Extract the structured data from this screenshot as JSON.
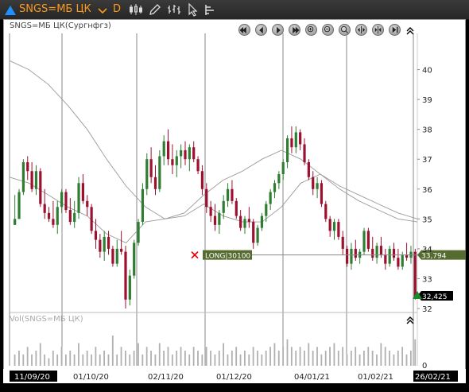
{
  "toolbar": {
    "symbol": "SNGS=МБ ЦК",
    "interval": "D",
    "accent_color": "#ff9a1a",
    "icons": [
      "triangle-up-icon",
      "chevron-down-icon",
      "candlestick-icon",
      "pencil-icon",
      "bar-style-icon",
      "cursor-icon",
      "indicators-icon"
    ]
  },
  "main_panel": {
    "title": "SNGS=МБ ЦК(Сургнфгз)",
    "nav_buttons": [
      "first-icon",
      "prev-icon",
      "play-icon",
      "last-icon",
      "zoom-in-icon",
      "zoom-out-icon",
      "zoom-fit-icon",
      "expand-icon",
      "compress-icon",
      "end-icon",
      "collapse-up-icon"
    ]
  },
  "volume_panel": {
    "title": "Vol(SNGS=МБ ЦК)",
    "zero_label": "0"
  },
  "order_line": {
    "label": "LONG|30100",
    "price": 33.794,
    "price_label": "33,794",
    "color": "#556b2f"
  },
  "last_price": {
    "value": 32.425,
    "label": "32,425"
  },
  "chart_data": {
    "type": "candlestick",
    "ylim": [
      32,
      41
    ],
    "y_ticks": [
      32,
      33,
      34,
      35,
      36,
      37,
      38,
      39,
      40
    ],
    "x_labels": [
      "11/09/20",
      "01/10/20",
      "02/11/20",
      "01/12/20",
      "04/01/21",
      "01/02/21",
      "26/02/21"
    ],
    "up_color": "#2e7d32",
    "down_color": "#9c1030",
    "candles": [
      [
        34.8,
        35.8,
        34.8,
        35.0
      ],
      [
        35.0,
        36.0,
        35.0,
        35.9
      ],
      [
        35.9,
        37.0,
        35.8,
        36.9
      ],
      [
        36.9,
        37.1,
        36.3,
        36.6
      ],
      [
        36.6,
        36.9,
        35.9,
        36.0
      ],
      [
        36.0,
        36.8,
        35.8,
        36.6
      ],
      [
        36.6,
        36.7,
        35.4,
        35.5
      ],
      [
        35.5,
        36.0,
        35.0,
        35.2
      ],
      [
        35.2,
        35.4,
        34.9,
        35.0
      ],
      [
        35.0,
        35.6,
        34.7,
        34.8
      ],
      [
        34.8,
        35.6,
        34.5,
        35.4
      ],
      [
        35.4,
        36.0,
        35.2,
        35.9
      ],
      [
        35.9,
        36.0,
        35.2,
        35.3
      ],
      [
        35.3,
        35.7,
        34.8,
        34.9
      ],
      [
        34.9,
        35.6,
        34.7,
        35.2
      ],
      [
        35.2,
        36.4,
        35.0,
        36.2
      ],
      [
        36.2,
        36.5,
        35.5,
        35.6
      ],
      [
        35.6,
        35.8,
        35.1,
        35.4
      ],
      [
        35.4,
        35.5,
        34.5,
        34.6
      ],
      [
        34.6,
        35.0,
        34.0,
        34.3
      ],
      [
        34.3,
        34.5,
        33.7,
        33.9
      ],
      [
        33.9,
        34.6,
        33.6,
        34.4
      ],
      [
        34.4,
        34.6,
        33.8,
        34.0
      ],
      [
        34.0,
        34.1,
        33.4,
        33.5
      ],
      [
        33.5,
        34.3,
        33.4,
        34.0
      ],
      [
        34.0,
        34.6,
        33.8,
        33.9
      ],
      [
        33.9,
        34.1,
        32.0,
        32.3
      ],
      [
        32.3,
        33.3,
        32.1,
        33.1
      ],
      [
        33.1,
        34.3,
        33.0,
        34.2
      ],
      [
        34.2,
        35.0,
        34.1,
        34.9
      ],
      [
        34.9,
        36.2,
        34.8,
        36.0
      ],
      [
        36.0,
        37.2,
        35.8,
        37.0
      ],
      [
        37.0,
        37.4,
        36.2,
        36.4
      ],
      [
        36.4,
        36.8,
        35.8,
        36.0
      ],
      [
        36.0,
        37.3,
        35.9,
        37.1
      ],
      [
        37.1,
        37.8,
        36.8,
        37.6
      ],
      [
        37.6,
        38.0,
        36.8,
        37.0
      ],
      [
        37.0,
        37.5,
        36.5,
        36.8
      ],
      [
        36.8,
        37.3,
        36.4,
        37.1
      ],
      [
        37.1,
        37.5,
        36.7,
        37.3
      ],
      [
        37.3,
        37.6,
        36.8,
        37.0
      ],
      [
        37.0,
        37.5,
        36.6,
        37.4
      ],
      [
        37.4,
        37.6,
        36.9,
        37.0
      ],
      [
        37.0,
        37.1,
        36.5,
        36.6
      ],
      [
        36.6,
        36.8,
        35.8,
        36.0
      ],
      [
        36.0,
        36.2,
        35.2,
        35.4
      ],
      [
        35.4,
        35.6,
        34.9,
        35.1
      ],
      [
        35.1,
        35.5,
        34.6,
        34.8
      ],
      [
        34.8,
        35.3,
        34.5,
        35.2
      ],
      [
        35.2,
        35.8,
        35.0,
        35.6
      ],
      [
        35.6,
        36.2,
        35.4,
        36.0
      ],
      [
        36.0,
        36.3,
        35.5,
        35.6
      ],
      [
        35.6,
        35.7,
        35.0,
        35.1
      ],
      [
        35.1,
        35.3,
        34.6,
        34.7
      ],
      [
        34.7,
        35.1,
        34.5,
        35.0
      ],
      [
        35.0,
        35.4,
        34.7,
        34.9
      ],
      [
        34.9,
        35.0,
        34.0,
        34.2
      ],
      [
        34.2,
        34.8,
        34.1,
        34.7
      ],
      [
        34.7,
        35.2,
        34.6,
        35.1
      ],
      [
        35.1,
        35.6,
        34.9,
        35.5
      ],
      [
        35.5,
        36.0,
        35.3,
        35.9
      ],
      [
        35.9,
        36.3,
        35.7,
        36.2
      ],
      [
        36.2,
        36.6,
        36.0,
        36.5
      ],
      [
        36.5,
        37.0,
        36.3,
        36.9
      ],
      [
        36.9,
        37.8,
        36.7,
        37.7
      ],
      [
        37.7,
        38.1,
        37.2,
        37.4
      ],
      [
        37.4,
        38.1,
        37.2,
        37.9
      ],
      [
        37.9,
        38.0,
        37.3,
        37.5
      ],
      [
        37.5,
        37.7,
        36.8,
        36.9
      ],
      [
        36.9,
        37.0,
        36.3,
        36.4
      ],
      [
        36.4,
        36.6,
        35.8,
        36.0
      ],
      [
        36.0,
        36.4,
        35.7,
        36.2
      ],
      [
        36.2,
        36.3,
        35.4,
        35.5
      ],
      [
        35.5,
        35.6,
        34.9,
        35.0
      ],
      [
        35.0,
        35.1,
        34.4,
        34.6
      ],
      [
        34.6,
        35.0,
        34.3,
        34.9
      ],
      [
        34.9,
        35.0,
        34.3,
        34.4
      ],
      [
        34.4,
        34.6,
        33.8,
        34.0
      ],
      [
        34.0,
        34.1,
        33.4,
        33.5
      ],
      [
        33.5,
        34.2,
        33.3,
        34.0
      ],
      [
        34.0,
        34.3,
        33.6,
        33.7
      ],
      [
        33.7,
        34.0,
        33.5,
        33.9
      ],
      [
        33.9,
        34.7,
        33.8,
        34.6
      ],
      [
        34.6,
        34.7,
        33.9,
        34.0
      ],
      [
        34.0,
        34.4,
        33.6,
        33.7
      ],
      [
        33.7,
        34.2,
        33.5,
        34.1
      ],
      [
        34.1,
        34.4,
        33.7,
        33.8
      ],
      [
        33.8,
        34.0,
        33.3,
        33.5
      ],
      [
        33.5,
        34.1,
        33.4,
        34.0
      ],
      [
        34.0,
        34.2,
        33.6,
        33.7
      ],
      [
        33.7,
        34.0,
        33.3,
        33.4
      ],
      [
        33.4,
        33.9,
        33.3,
        33.8
      ],
      [
        33.8,
        34.2,
        33.6,
        33.7
      ],
      [
        33.7,
        34.1,
        33.5,
        33.9
      ],
      [
        33.9,
        34.0,
        32.3,
        32.4
      ]
    ],
    "ma_long": [
      40.3,
      40.0,
      39.5,
      38.8,
      38.0,
      37.0,
      36.1,
      35.4,
      35.0,
      35.2,
      35.8,
      36.3,
      36.6,
      37.0,
      37.3,
      37.0,
      36.5,
      36.1,
      35.8,
      35.5,
      35.2,
      35.0
    ],
    "ma_short": [
      36.4,
      36.2,
      35.8,
      35.4,
      35.1,
      34.5,
      34.2,
      34.9,
      35.0,
      35.1,
      35.5,
      35.1,
      34.9,
      34.9,
      35.4,
      36.2,
      36.5,
      36.0,
      35.6,
      35.3,
      35.0,
      34.9
    ],
    "volume": [
      3,
      4,
      3,
      5,
      3,
      4,
      6,
      3,
      2,
      4,
      3,
      5,
      3,
      4,
      3,
      6,
      3,
      4,
      3,
      5,
      3,
      4,
      3,
      8,
      3,
      5,
      4,
      3,
      4,
      6,
      3,
      5,
      4,
      3,
      6,
      4,
      5,
      3,
      4,
      5,
      4,
      3,
      5,
      4,
      3,
      5,
      4,
      3,
      4,
      6,
      3,
      4,
      5,
      3,
      4,
      3,
      5,
      4,
      3,
      4,
      5,
      6,
      4,
      5,
      7,
      5,
      4,
      5,
      4,
      6,
      4,
      5,
      3,
      4,
      5,
      6,
      4,
      5,
      3,
      4,
      5,
      3,
      4,
      5,
      4,
      3,
      6,
      5,
      4,
      3,
      4,
      5,
      3,
      4,
      7
    ]
  }
}
